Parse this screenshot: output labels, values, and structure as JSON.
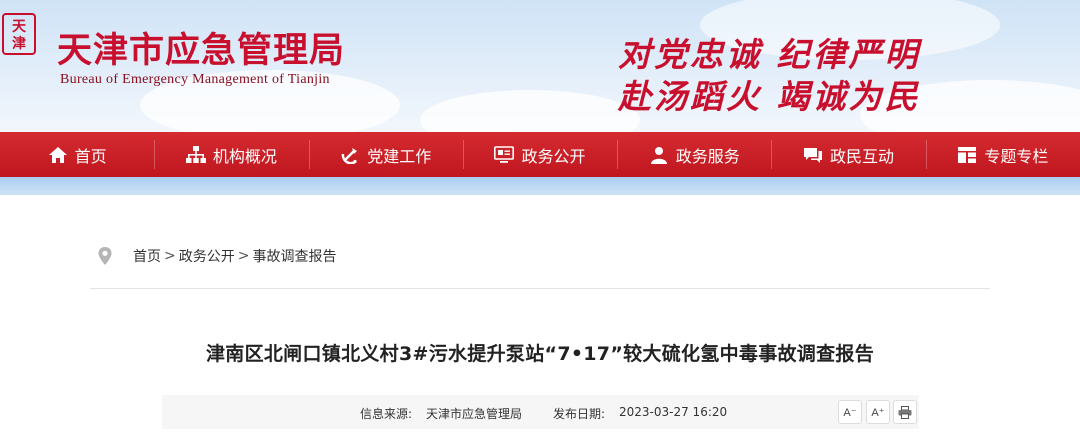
{
  "header": {
    "seal_text": "天津",
    "site_title": "天津市应急管理局",
    "site_subtitle": "Bureau  of Emergency Management of Tianjin",
    "slogan_line1": "对党忠诚  纪律严明",
    "slogan_line2": "赴汤蹈火  竭诚为民"
  },
  "nav": {
    "items": [
      {
        "label": "首页",
        "icon": "home-icon"
      },
      {
        "label": "机构概况",
        "icon": "org-chart-icon"
      },
      {
        "label": "党建工作",
        "icon": "party-emblem-icon"
      },
      {
        "label": "政务公开",
        "icon": "monitor-icon"
      },
      {
        "label": "政务服务",
        "icon": "user-icon"
      },
      {
        "label": "政民互动",
        "icon": "chat-icon"
      },
      {
        "label": "专题专栏",
        "icon": "column-icon"
      }
    ]
  },
  "breadcrumb": {
    "items": [
      "首页",
      "政务公开",
      "事故调查报告"
    ],
    "separator": ">"
  },
  "article": {
    "title": "津南区北闸口镇北义村3#污水提升泵站“7•17”较大硫化氢中毒事故调查报告",
    "source_label": "信息来源:",
    "source_value": "天津市应急管理局",
    "date_label": "发布日期:",
    "date_value": "2023-03-27 16:20",
    "font_decrease": "A⁻",
    "font_increase": "A⁺"
  },
  "colors": {
    "brand_red": "#c8102e",
    "nav_red": "#c91a22",
    "sky_blue": "#cfe3f6"
  }
}
